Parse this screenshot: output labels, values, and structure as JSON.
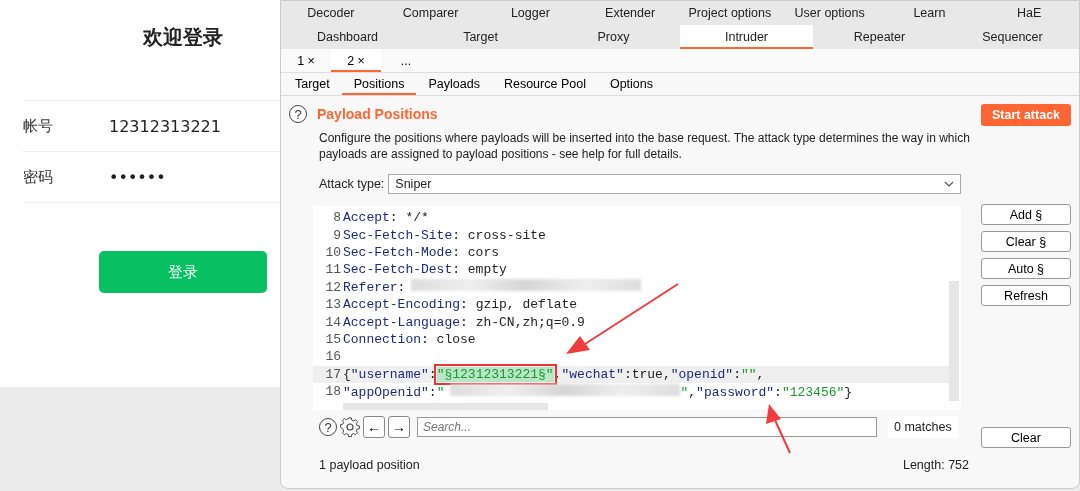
{
  "login_page": {
    "title": "欢迎登录",
    "fields": [
      {
        "label": "帐号",
        "value": "12312313221"
      },
      {
        "label": "密码",
        "value": "••••••"
      }
    ],
    "submit": "登录"
  },
  "burp": {
    "top_tabs": [
      {
        "label": "Decoder",
        "selected": false
      },
      {
        "label": "Comparer",
        "selected": false
      },
      {
        "label": "Logger",
        "selected": false
      },
      {
        "label": "Extender",
        "selected": false
      },
      {
        "label": "Project options",
        "selected": false
      },
      {
        "label": "User options",
        "selected": false
      },
      {
        "label": "Learn",
        "selected": false
      },
      {
        "label": "HaE",
        "selected": false
      }
    ],
    "main_tabs": [
      {
        "label": "Dashboard",
        "selected": false
      },
      {
        "label": "Target",
        "selected": false
      },
      {
        "label": "Proxy",
        "selected": false
      },
      {
        "label": "Intruder",
        "selected": true
      },
      {
        "label": "Repeater",
        "selected": false
      },
      {
        "label": "Sequencer",
        "selected": false
      }
    ],
    "request_tabs": [
      {
        "label": "1 ×",
        "selected": false
      },
      {
        "label": "2 ×",
        "selected": true
      },
      {
        "label": "...",
        "selected": false
      }
    ],
    "sub_tabs": [
      {
        "label": "Target",
        "selected": false
      },
      {
        "label": "Positions",
        "selected": true
      },
      {
        "label": "Payloads",
        "selected": false
      },
      {
        "label": "Resource Pool",
        "selected": false
      },
      {
        "label": "Options",
        "selected": false
      }
    ],
    "help_icon": "?",
    "heading": "Payload Positions",
    "start_button": "Start attack",
    "description": "Configure the positions where payloads will be inserted into the base request. The attack type determines the way in which payloads are assigned to payload positions - see help for full details.",
    "attack_type_label": "Attack type:",
    "attack_type": "Sniper",
    "editor_lines": [
      {
        "number": "8",
        "current": false,
        "parts": [
          {
            "kind": "name",
            "text": "Accept"
          },
          {
            "kind": "plain",
            "text": ": */*"
          }
        ]
      },
      {
        "number": "9",
        "current": false,
        "parts": [
          {
            "kind": "name",
            "text": "Sec-Fetch-Site"
          },
          {
            "kind": "plain",
            "text": ": cross-site"
          }
        ]
      },
      {
        "number": "10",
        "current": false,
        "parts": [
          {
            "kind": "name",
            "text": "Sec-Fetch-Mode"
          },
          {
            "kind": "plain",
            "text": ": cors"
          }
        ]
      },
      {
        "number": "11",
        "current": false,
        "parts": [
          {
            "kind": "name",
            "text": "Sec-Fetch-Dest"
          },
          {
            "kind": "plain",
            "text": ": empty"
          }
        ]
      },
      {
        "number": "12",
        "current": false,
        "parts": [
          {
            "kind": "name",
            "text": "Referer"
          },
          {
            "kind": "plain",
            "text": ":"
          },
          {
            "kind": "redacted"
          }
        ]
      },
      {
        "number": "13",
        "current": false,
        "parts": [
          {
            "kind": "name",
            "text": "Accept-Encoding"
          },
          {
            "kind": "plain",
            "text": ": gzip, deflate"
          }
        ]
      },
      {
        "number": "14",
        "current": false,
        "parts": [
          {
            "kind": "name",
            "text": "Accept-Language"
          },
          {
            "kind": "plain",
            "text": ": zh-CN,zh;q=0.9"
          }
        ]
      },
      {
        "number": "15",
        "current": false,
        "parts": [
          {
            "kind": "name",
            "text": "Connection"
          },
          {
            "kind": "plain",
            "text": ": close"
          }
        ]
      },
      {
        "number": "16",
        "current": false
      },
      {
        "number": "17",
        "current": true,
        "parts": [
          {
            "kind": "plain",
            "text": "{"
          },
          {
            "kind": "name",
            "text": "\"username\""
          },
          {
            "kind": "plain",
            "text": ":"
          },
          {
            "kind": "payload",
            "text": "\"§12312313221§\""
          },
          {
            "kind": "plain",
            "text": ","
          },
          {
            "kind": "name",
            "text": "\"wechat\""
          },
          {
            "kind": "plain",
            "text": ":true,"
          },
          {
            "kind": "name",
            "text": "\"openid\""
          },
          {
            "kind": "plain",
            "text": ":"
          },
          {
            "kind": "string",
            "text": "\"\""
          },
          {
            "kind": "plain",
            "text": ","
          }
        ]
      },
      {
        "number": "18",
        "current": false,
        "parts": [
          {
            "kind": "name",
            "text": "\"appOpenid\""
          },
          {
            "kind": "plain",
            "text": ":"
          },
          {
            "kind": "string",
            "text": "\""
          },
          {
            "kind": "redacted"
          },
          {
            "kind": "string",
            "text": "\""
          },
          {
            "kind": "plain",
            "text": ","
          },
          {
            "kind": "name",
            "text": "\"password\""
          },
          {
            "kind": "plain",
            "text": ":"
          },
          {
            "kind": "string",
            "text": "\"123456\""
          },
          {
            "kind": "plain",
            "text": "}"
          }
        ]
      }
    ],
    "side_buttons": [
      "Add §",
      "Clear §",
      "Auto §",
      "Refresh"
    ],
    "back_button": "←",
    "forward_button": "→",
    "search": {
      "placeholder": "Search..."
    },
    "matches": "0 matches",
    "clear_button": "Clear",
    "status": "1 payload position",
    "length": "Length: 752"
  }
}
